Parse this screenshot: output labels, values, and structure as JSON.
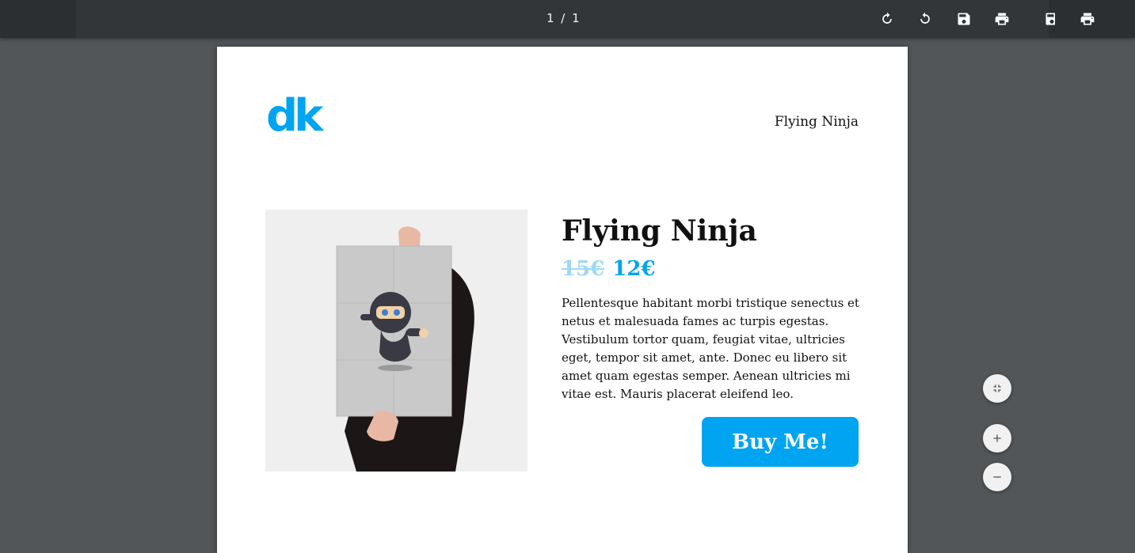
{
  "viewer": {
    "page_count": "1 / 1",
    "icons": {
      "rotate_cw": "rotate-clockwise-icon",
      "rotate_ccw": "rotate-counterclockwise-icon",
      "save": "save-icon",
      "print": "print-icon",
      "fit": "fit-to-page-icon",
      "zoom_in": "zoom-in-icon",
      "zoom_out": "zoom-out-icon"
    }
  },
  "document": {
    "logo_text": "dk",
    "header_title": "Flying Ninja",
    "product": {
      "title": "Flying Ninja",
      "price_old": "15€",
      "price_new": "12€",
      "description": "Pellentesque habitant morbi tristique senectus et netus et malesuada fames ac turpis egestas. Vestibulum tortor quam, feugiat vitae, ultricies eget, tempor sit amet, ante. Donec eu libero sit amet quam egestas semper. Aenean ultricies mi vitae est. Mauris placerat eleifend leo.",
      "buy_label": "Buy Me!"
    }
  },
  "colors": {
    "accent": "#00a4f0",
    "toolbar": "#323639",
    "viewer_bg": "#525659"
  }
}
